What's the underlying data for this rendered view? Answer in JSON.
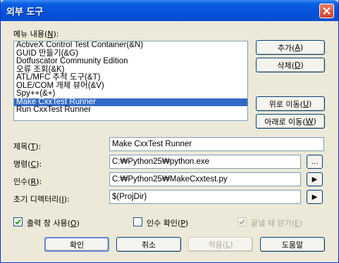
{
  "window": {
    "title": "외부 도구"
  },
  "menu": {
    "label_prefix": "메뉴 내용(",
    "label_key": "N",
    "label_suffix": "):",
    "items": [
      "ActiveX Control Test Container(&N)",
      "GUID 만들기(&G)",
      "Dotfuscator Community Edition",
      "오류 조회(&K)",
      "ATL/MFC 추적 도구(&T)",
      "OLE/COM 개체 뷰어(&V)",
      "Spy++(&+)",
      "Make CxxTest Runner",
      "Run CxxTest Runner"
    ],
    "selected_index": 7
  },
  "side_buttons": {
    "add": {
      "text": "추가(",
      "key": "A",
      "end": ")"
    },
    "delete": {
      "text": "삭제(",
      "key": "D",
      "end": ")"
    },
    "move_up": {
      "text": "위로 이동(",
      "key": "U",
      "end": ")"
    },
    "move_down": {
      "text": "아래로 이동(",
      "key": "W",
      "end": ")"
    }
  },
  "fields": {
    "title": {
      "label": "제목(",
      "key": "T",
      "end": "):",
      "value": "Make CxxTest Runner"
    },
    "command": {
      "label": "명령(",
      "key": "C",
      "end": "):",
      "value": "C:₩Python25₩python.exe",
      "button": "..."
    },
    "arguments": {
      "label": "인수(",
      "key": "R",
      "end": "):",
      "value": "C:₩Python25₩MakeCxxtest.py",
      "button": "▶"
    },
    "initial_dir": {
      "label": "초기 디렉터리(",
      "key": "I",
      "end": "):",
      "value": "$(ProjDir)",
      "button": "▶"
    }
  },
  "checkboxes": {
    "use_output": {
      "label": "출력 창 사용(",
      "key": "O",
      "end": ")",
      "checked": true
    },
    "prompt_args": {
      "label": "인수 확인(",
      "key": "P",
      "end": ")",
      "checked": false
    },
    "close_on_exit": {
      "label": "끝낼 때 닫기(",
      "key": "E",
      "end": ")",
      "checked": true
    }
  },
  "footer": {
    "ok": "확인",
    "cancel": "취소",
    "apply": {
      "text": "적용(",
      "key": "L",
      "end": ")"
    },
    "help": "도움말"
  }
}
